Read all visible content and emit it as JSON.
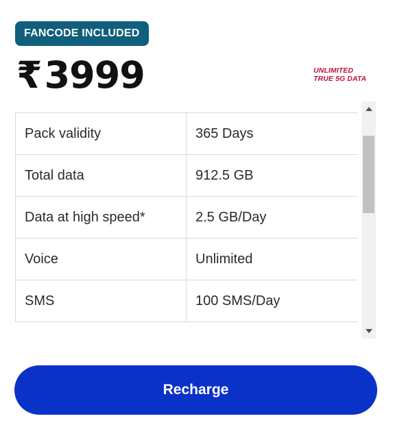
{
  "plan": {
    "badge": "FANCODE INCLUDED",
    "currency_symbol": "₹",
    "price": "3999",
    "promo_tag_line1": "UNLIMITED",
    "promo_tag_line2": "TRUE 5G DATA",
    "promo_color": "#c0123a",
    "badge_color": "#0f5f7d"
  },
  "details": [
    {
      "label": "Pack validity",
      "value": "365 Days"
    },
    {
      "label": "Total data",
      "value": "912.5 GB"
    },
    {
      "label": "Data at high speed*",
      "value": "2.5 GB/Day"
    },
    {
      "label": "Voice",
      "value": "Unlimited"
    },
    {
      "label": "SMS",
      "value": "100 SMS/Day"
    }
  ],
  "scroll": {
    "up_icon": "triangle-up-icon",
    "down_icon": "triangle-down-icon"
  },
  "actions": {
    "recharge_label": "Recharge",
    "recharge_color": "#0b32c8"
  }
}
